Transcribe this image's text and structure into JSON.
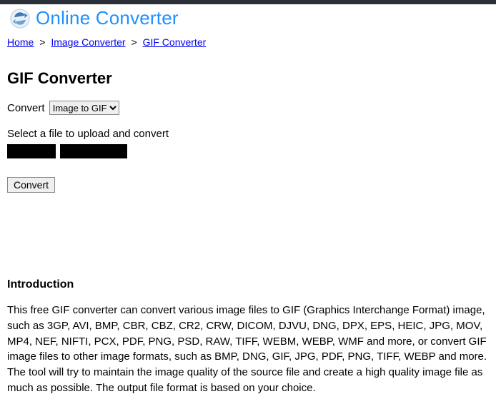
{
  "site": {
    "title": "Online Converter"
  },
  "breadcrumb": {
    "home": "Home",
    "sep": ">",
    "image_converter": "Image Converter",
    "gif_converter": "GIF Converter"
  },
  "page": {
    "title": "GIF Converter"
  },
  "form": {
    "convert_label": "Convert",
    "convert_select_value": "Image to GIF",
    "select_file_label": "Select a file to upload and convert",
    "convert_button": "Convert"
  },
  "intro": {
    "heading": "Introduction",
    "text": "This free GIF converter can convert various image files to GIF (Graphics Interchange Format) image, such as 3GP, AVI, BMP, CBR, CBZ, CR2, CRW, DICOM, DJVU, DNG, DPX, EPS, HEIC, JPG, MOV, MP4, NEF, NIFTI, PCX, PDF, PNG, PSD, RAW, TIFF, WEBM, WEBP, WMF and more, or convert GIF image files to other image formats, such as BMP, DNG, GIF, JPG, PDF, PNG, TIFF, WEBP and more. The tool will try to maintain the image quality of the source file and create a high quality image file as much as possible. The output file format is based on your choice."
  }
}
